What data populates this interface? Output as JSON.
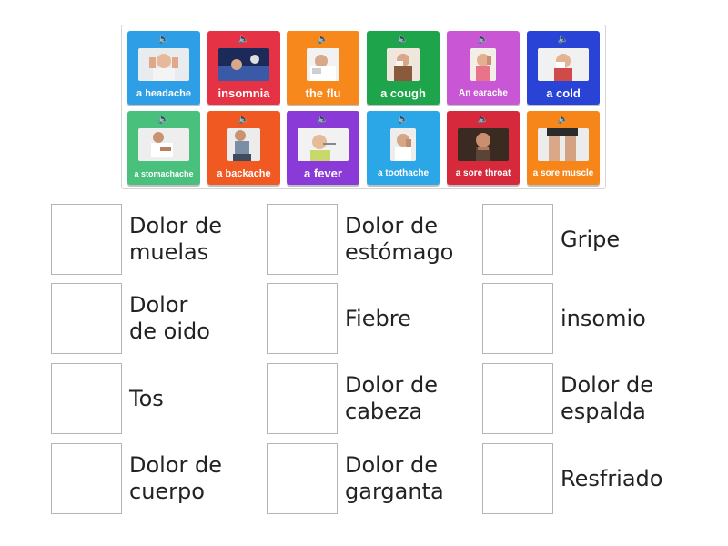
{
  "tiles": [
    {
      "label": "a headache",
      "color": "#2e9fe6"
    },
    {
      "label": "insomnia",
      "color": "#e53345"
    },
    {
      "label": "the flu",
      "color": "#f7881c"
    },
    {
      "label": "a cough",
      "color": "#1ea44a"
    },
    {
      "label": "An earache",
      "color": "#c956d4"
    },
    {
      "label": "a cold",
      "color": "#2843d6"
    },
    {
      "label": "a stomachache",
      "color": "#49c07c"
    },
    {
      "label": "a backache",
      "color": "#f05a22"
    },
    {
      "label": "a fever",
      "color": "#8a3ad6"
    },
    {
      "label": "a toothache",
      "color": "#2ba6e6"
    },
    {
      "label": "a sore throat",
      "color": "#d6293b"
    },
    {
      "label": "a sore muscle",
      "color": "#f7861a"
    }
  ],
  "speaker_icon": "speaker-icon",
  "answers": [
    [
      "Dolor de",
      "muelas"
    ],
    [
      "Dolor de",
      "estómago"
    ],
    [
      "Gripe"
    ],
    [
      "Dolor",
      "de oido"
    ],
    [
      "Fiebre"
    ],
    [
      "insomio"
    ],
    [
      "Tos"
    ],
    [
      "Dolor de",
      "cabeza"
    ],
    [
      "Dolor de",
      "espalda"
    ],
    [
      "Dolor de",
      "cuerpo"
    ],
    [
      "Dolor de",
      "garganta"
    ],
    [
      "Resfriado"
    ]
  ]
}
